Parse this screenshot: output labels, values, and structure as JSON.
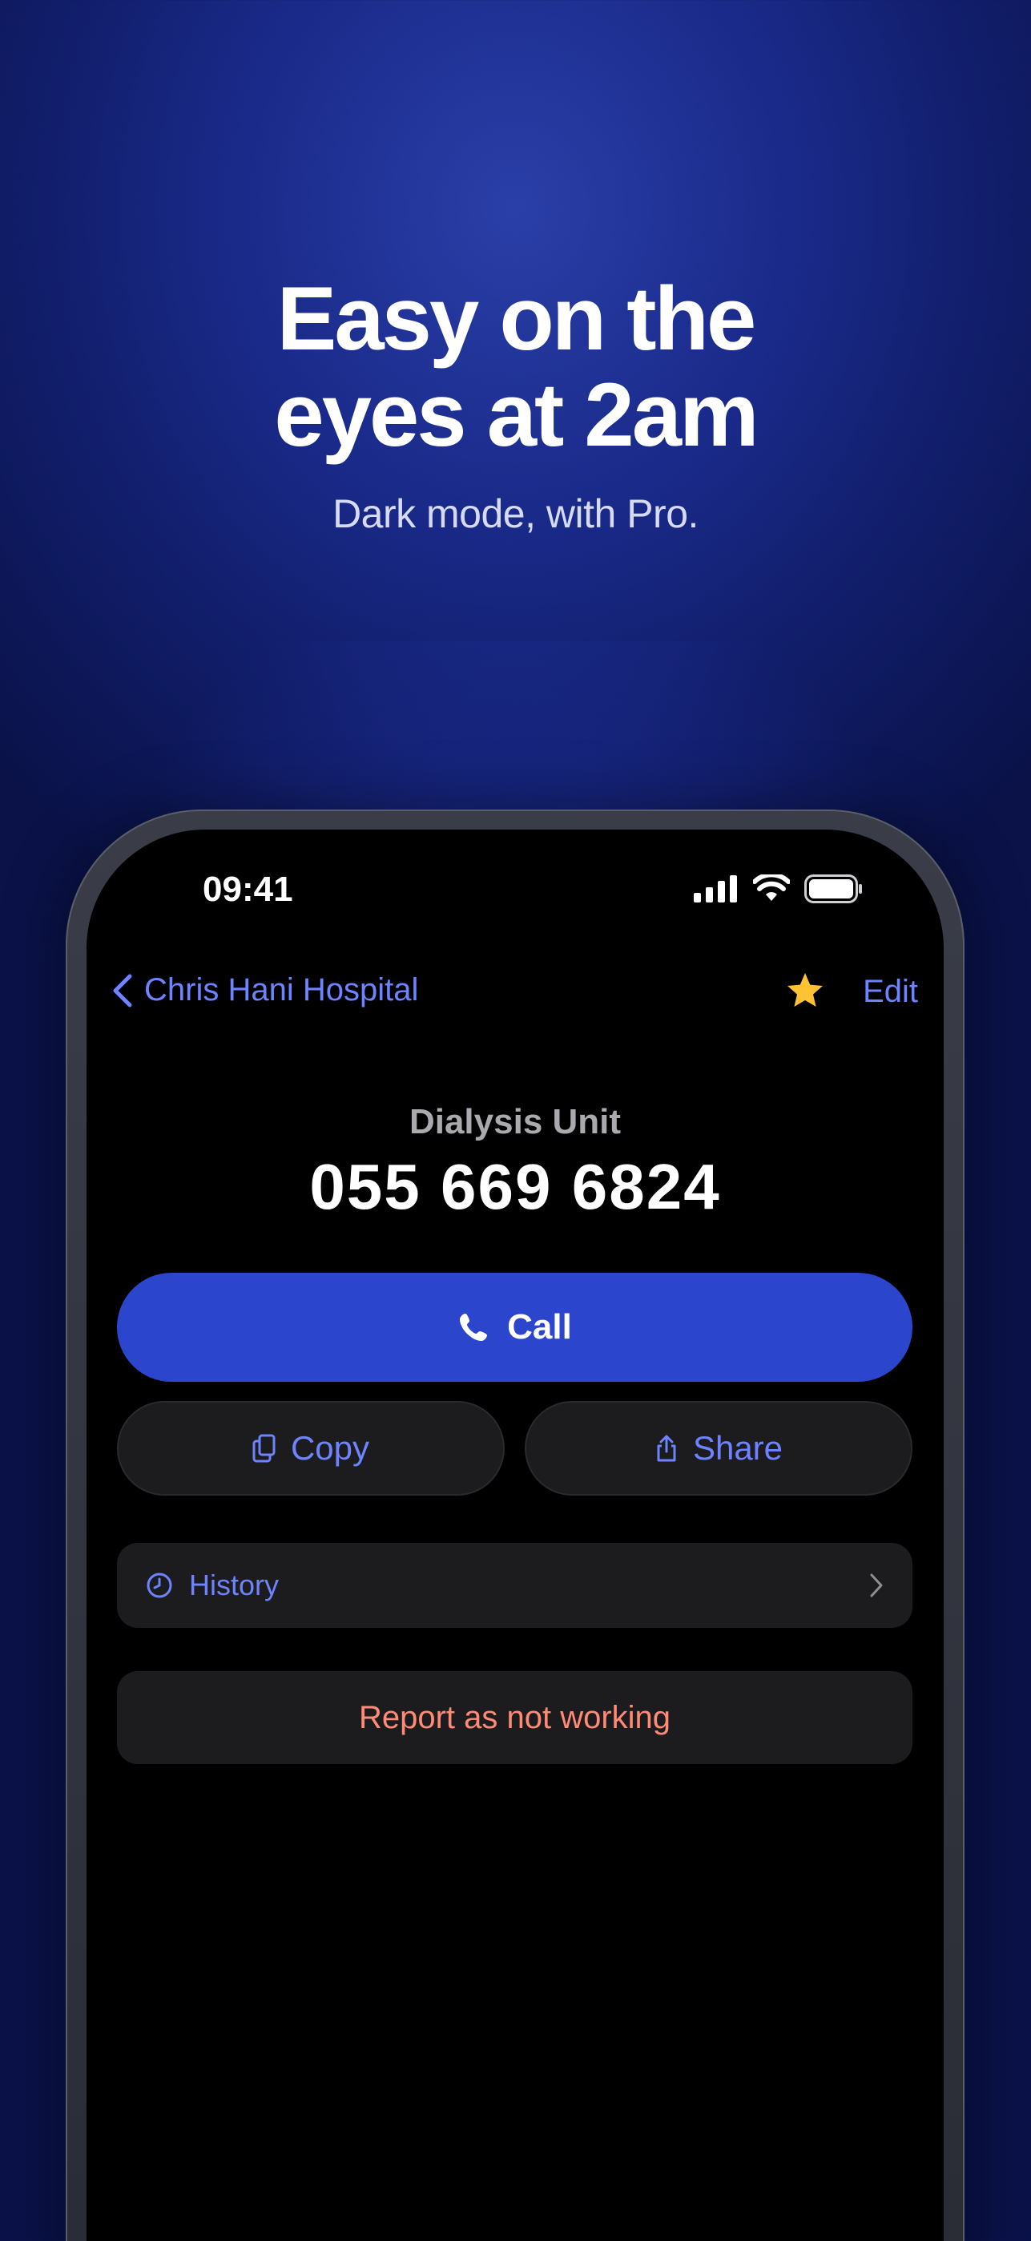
{
  "marketing": {
    "title_line1": "Easy on the",
    "title_line2": "eyes at 2am",
    "subtitle": "Dark mode, with Pro."
  },
  "status_bar": {
    "time": "09:41",
    "icons": [
      "signal-icon",
      "wifi-icon",
      "battery-icon"
    ]
  },
  "nav": {
    "back_label": "Chris Hani Hospital",
    "favorite_icon": "star-icon",
    "edit_label": "Edit"
  },
  "contact": {
    "unit": "Dialysis Unit",
    "number": "055 669 6824"
  },
  "actions": {
    "call_label": "Call",
    "copy_label": "Copy",
    "share_label": "Share",
    "history_label": "History",
    "report_label": "Report as not working"
  },
  "colors": {
    "accent": "#6d83ff",
    "call_button": "#2b46cc",
    "report_text": "#ff8a75",
    "star": "#ffc233",
    "background": "#1a2a8a"
  }
}
